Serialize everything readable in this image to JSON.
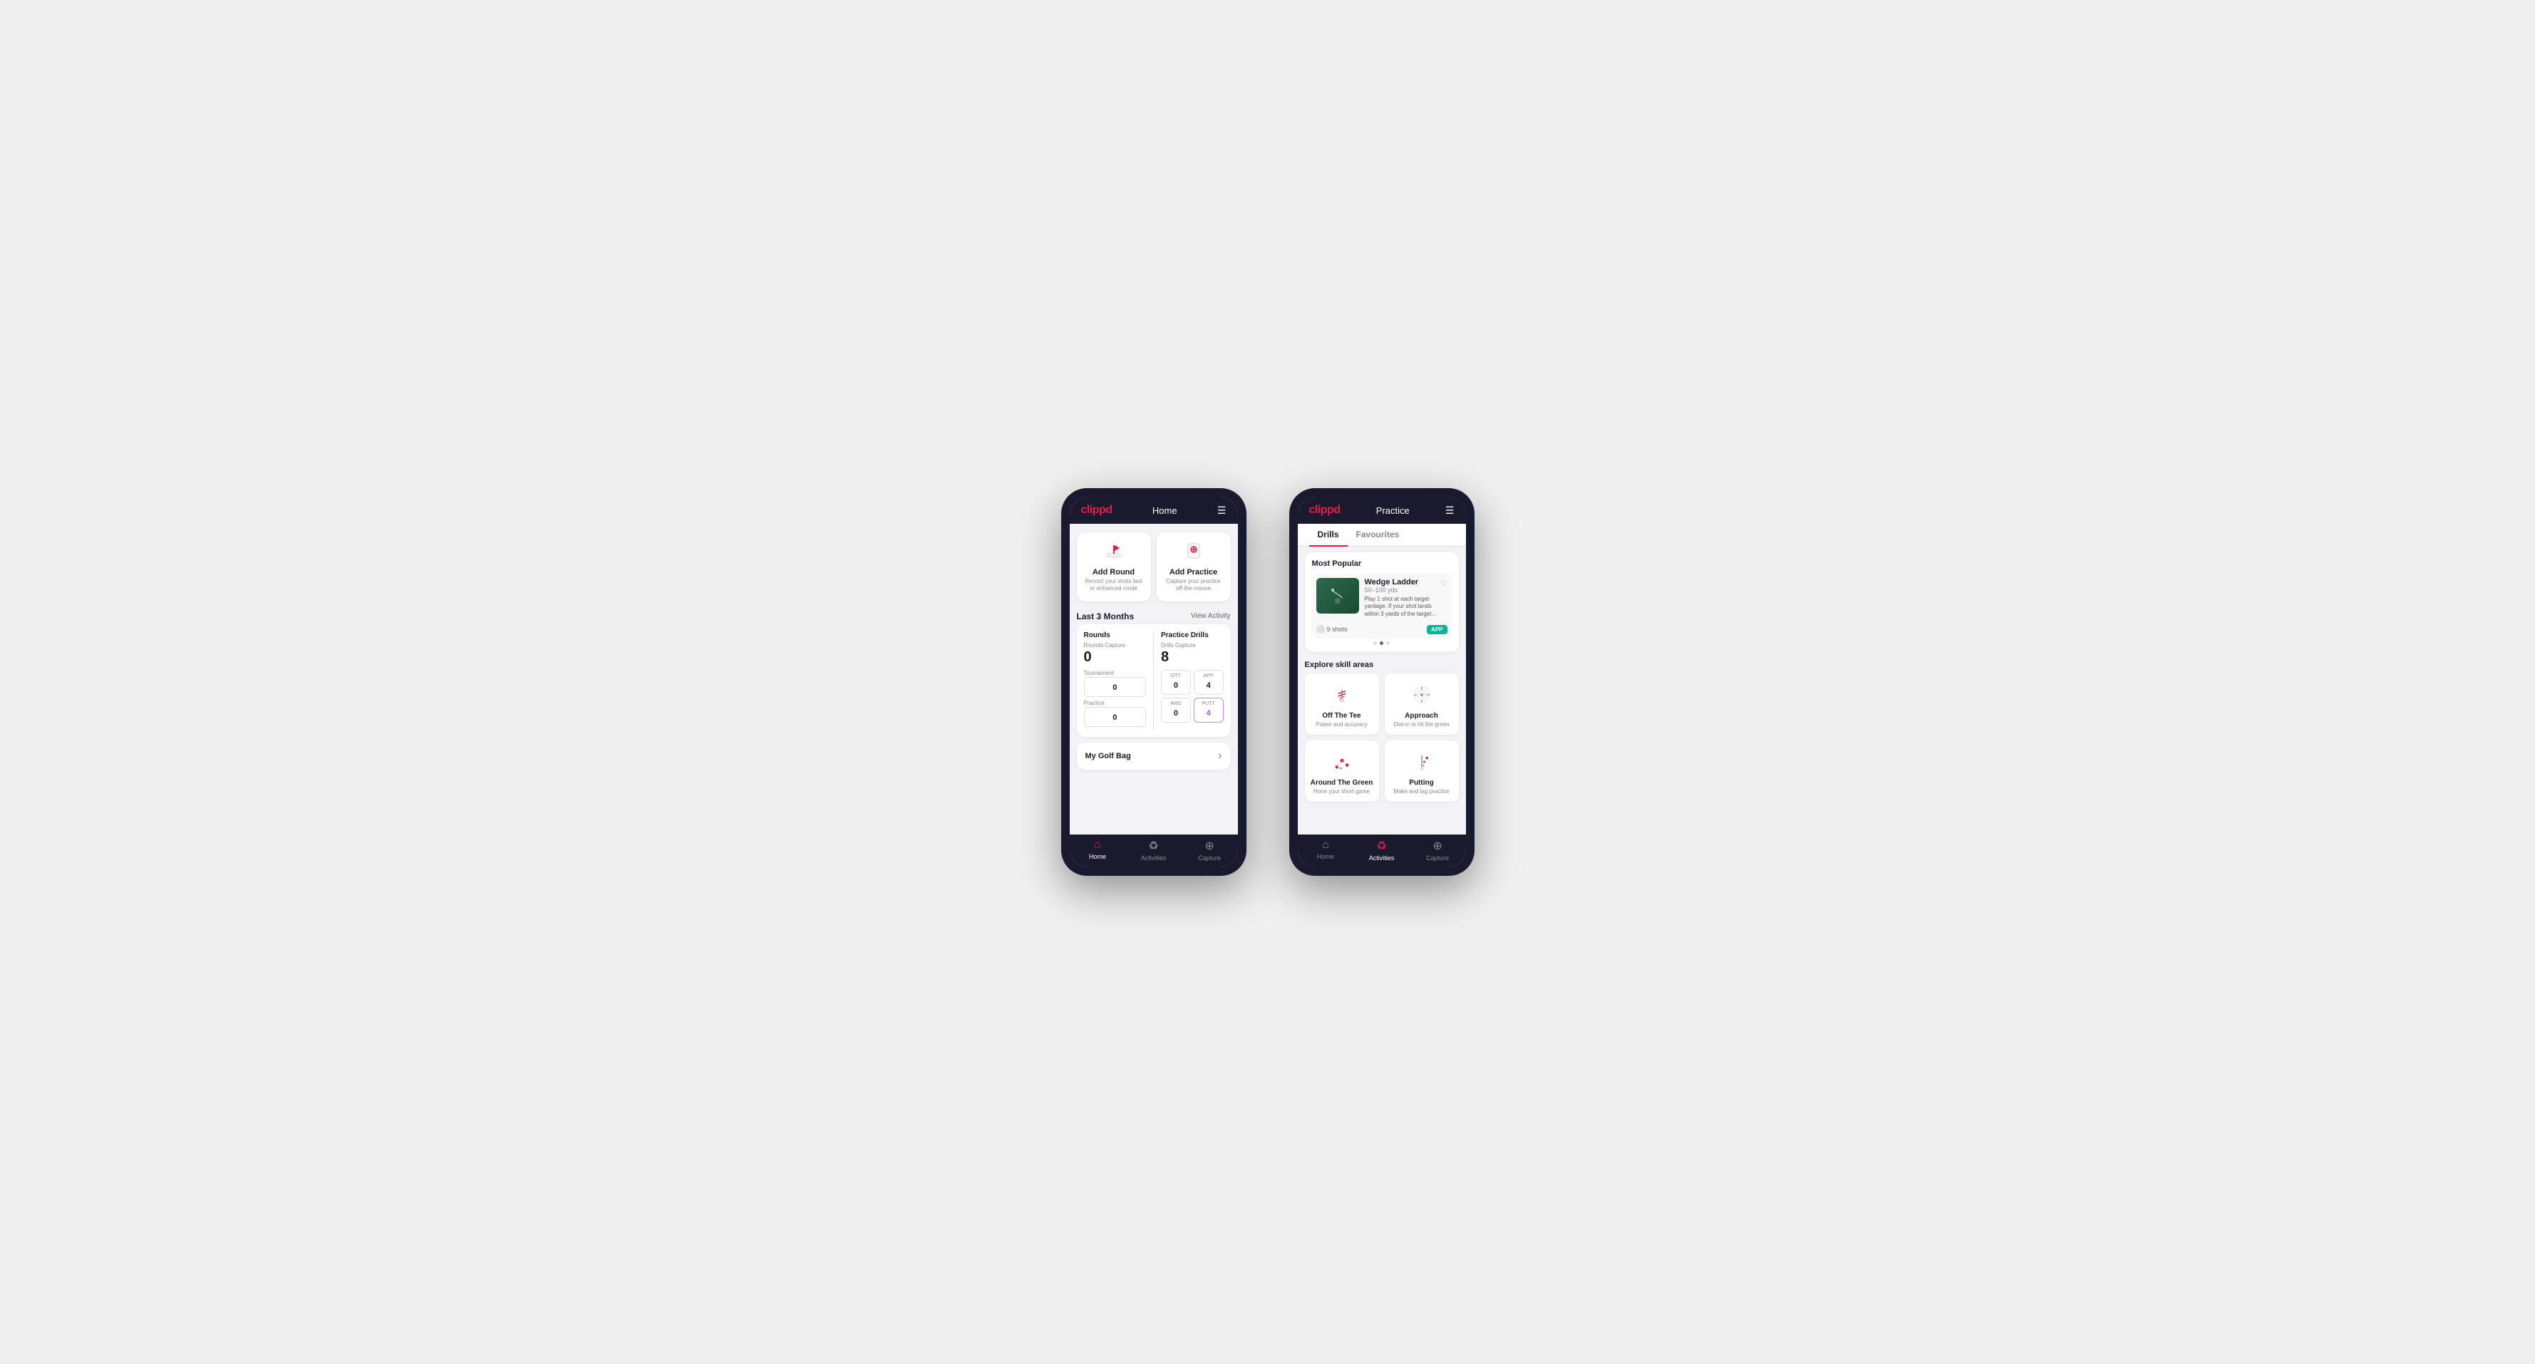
{
  "phone1": {
    "header": {
      "logo": "clippd",
      "title": "Home",
      "menu_icon": "☰"
    },
    "cards": [
      {
        "id": "add-round",
        "icon": "⛳",
        "title": "Add Round",
        "subtitle": "Record your shots fast or enhanced mode"
      },
      {
        "id": "add-practice",
        "icon": "📋",
        "title": "Add Practice",
        "subtitle": "Capture your practice off-the-course"
      }
    ],
    "activity_section": {
      "title": "Last 3 Months",
      "link": "View Activity"
    },
    "rounds": {
      "title": "Rounds",
      "capture_label": "Rounds Capture",
      "capture_value": "0",
      "tournament_label": "Tournament",
      "tournament_value": "0",
      "practice_label": "Practice",
      "practice_value": "0"
    },
    "practice_drills": {
      "title": "Practice Drills",
      "capture_label": "Drills Capture",
      "capture_value": "8",
      "ott_label": "OTT",
      "ott_value": "0",
      "app_label": "APP",
      "app_value": "4",
      "arg_label": "ARG",
      "arg_value": "0",
      "putt_label": "PUTT",
      "putt_value": "4"
    },
    "golf_bag": {
      "label": "My Golf Bag",
      "arrow": "›"
    },
    "nav": [
      {
        "id": "home",
        "icon": "🏠",
        "label": "Home",
        "active": true
      },
      {
        "id": "activities",
        "icon": "⚽",
        "label": "Activities",
        "active": false
      },
      {
        "id": "capture",
        "icon": "➕",
        "label": "Capture",
        "active": false
      }
    ]
  },
  "phone2": {
    "header": {
      "logo": "clippd",
      "title": "Practice",
      "menu_icon": "☰"
    },
    "tabs": [
      {
        "id": "drills",
        "label": "Drills",
        "active": true
      },
      {
        "id": "favourites",
        "label": "Favourites",
        "active": false
      }
    ],
    "most_popular": {
      "title": "Most Popular",
      "drill": {
        "title": "Wedge Ladder",
        "yardage": "50–100 yds",
        "description": "Play 1 shot at each target yardage. If your shot lands within 3 yards of the target...",
        "shots": "9 shots",
        "badge": "APP",
        "star": "☆"
      },
      "dots": [
        false,
        true,
        false
      ]
    },
    "explore": {
      "title": "Explore skill areas",
      "skills": [
        {
          "id": "off-the-tee",
          "name": "Off The Tee",
          "subtitle": "Power and accuracy"
        },
        {
          "id": "approach",
          "name": "Approach",
          "subtitle": "Dial-in to hit the green"
        },
        {
          "id": "around-the-green",
          "name": "Around The Green",
          "subtitle": "Hone your short game"
        },
        {
          "id": "putting",
          "name": "Putting",
          "subtitle": "Make and lag practice"
        }
      ]
    },
    "nav": [
      {
        "id": "home",
        "icon": "🏠",
        "label": "Home",
        "active": false
      },
      {
        "id": "activities",
        "icon": "⚽",
        "label": "Activities",
        "active": true
      },
      {
        "id": "capture",
        "icon": "➕",
        "label": "Capture",
        "active": false
      }
    ]
  },
  "colors": {
    "brand_red": "#e8194b",
    "dark_bg": "#1a1a2e",
    "card_bg": "#ffffff",
    "text_primary": "#1a1a2e",
    "text_secondary": "#888888"
  }
}
